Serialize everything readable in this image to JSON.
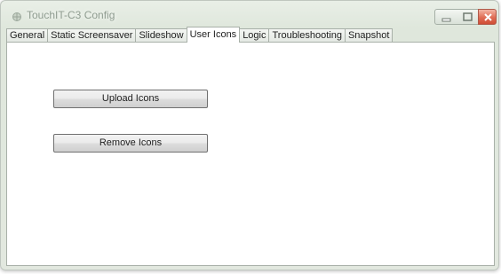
{
  "window": {
    "title": "TouchIT-C3 Config",
    "controls": [
      "minimize",
      "maximize",
      "close"
    ]
  },
  "tabs": [
    {
      "label": "General",
      "active": false
    },
    {
      "label": "Static Screensaver",
      "active": false
    },
    {
      "label": "Slideshow",
      "active": false
    },
    {
      "label": "User Icons",
      "active": true
    },
    {
      "label": "Logic",
      "active": false
    },
    {
      "label": "Troubleshooting",
      "active": false
    },
    {
      "label": "Snapshot",
      "active": false
    }
  ],
  "user_icons": {
    "upload_label": "Upload Icons",
    "remove_label": "Remove Icons"
  }
}
